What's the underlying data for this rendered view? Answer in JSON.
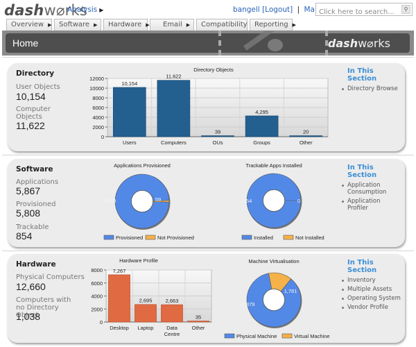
{
  "header": {
    "logo_bold": "dash",
    "logo_rest": "w⌀rks",
    "breadcrumb": "Analysis",
    "user": "bangell",
    "logout": "[Logout]",
    "separator": "|",
    "manage": "Manage",
    "search_placeholder": "Click here to search...",
    "search_icon": "search-icon"
  },
  "nav": {
    "tabs": [
      {
        "label": "Overview"
      },
      {
        "label": "Software"
      },
      {
        "label": "Hardware"
      },
      {
        "label": "Email"
      },
      {
        "label": "Compatibility"
      },
      {
        "label": "Reporting"
      }
    ]
  },
  "page": {
    "title": "Home",
    "brand_bold": "dash",
    "brand_rest": "w⌀rks"
  },
  "colors": {
    "bar_blue": "#235f8f",
    "bar_orange": "#e06a42",
    "donut_blue": "#5389e6",
    "donut_orange": "#f5b249",
    "link_blue": "#3b8ed6"
  },
  "directory": {
    "title": "Directory",
    "stats": [
      {
        "label": "User Objects",
        "value": "10,154"
      },
      {
        "label": "Computer Objects",
        "value": "11,622"
      }
    ],
    "section_heading": "In This Section",
    "links": [
      "Directory Browse"
    ]
  },
  "software": {
    "title": "Software",
    "stats": [
      {
        "label": "Applications",
        "value": "5,867"
      },
      {
        "label": "Provisioned",
        "value": "5,808"
      },
      {
        "label": "Trackable",
        "value": "854"
      }
    ],
    "section_heading": "In This Section",
    "links": [
      "Application Consumption",
      "Application Profiler"
    ]
  },
  "hardware": {
    "title": "Hardware",
    "stats": [
      {
        "label": "Physical Computers",
        "value": "12,660"
      },
      {
        "label": "Computers with no Directory Object",
        "value": "1,038"
      }
    ],
    "section_heading": "In This Section",
    "links": [
      "Inventory",
      "Multiple Assets",
      "Operating System",
      "Vendor Profile"
    ]
  },
  "chart_data": [
    {
      "id": "directory-objects",
      "type": "bar",
      "title": "Directory Objects",
      "categories": [
        "Users",
        "Computers",
        "OUs",
        "Groups",
        "Other"
      ],
      "values": [
        10154,
        11622,
        39,
        4295,
        20
      ],
      "labels": [
        "10,154",
        "11,622",
        "39",
        "4,295",
        "20"
      ],
      "yticks": [
        0,
        2000,
        4000,
        6000,
        8000,
        10000,
        12000
      ],
      "ylim": [
        0,
        12000
      ],
      "grid": true,
      "xlabel": "",
      "ylabel": ""
    },
    {
      "id": "applications-provisioned",
      "type": "pie",
      "donut": true,
      "title": "Applications Provisioned",
      "categories": [
        "Provisioned",
        "Not Provisioned"
      ],
      "values": [
        5808,
        59
      ],
      "labels": [
        "5,808",
        "59"
      ],
      "legend": "bottom"
    },
    {
      "id": "trackable-apps-installed",
      "type": "pie",
      "donut": true,
      "title": "Trackable Apps Installed",
      "categories": [
        "Installed",
        "Not Installed"
      ],
      "values": [
        854,
        0
      ],
      "labels": [
        "854",
        "0"
      ],
      "legend": "bottom"
    },
    {
      "id": "hardware-profile",
      "type": "bar",
      "title": "Hardware Profile",
      "categories": [
        "Desktop",
        "Laptop",
        "Data Centre",
        "Other"
      ],
      "values": [
        7267,
        2695,
        2663,
        35
      ],
      "labels": [
        "7,267",
        "2,695",
        "2,663",
        "35"
      ],
      "yticks": [
        0,
        2000,
        4000,
        6000,
        8000
      ],
      "ylim": [
        0,
        8000
      ],
      "grid": true,
      "xlabel": "",
      "ylabel": ""
    },
    {
      "id": "machine-virtualisation",
      "type": "pie",
      "donut": true,
      "title": "Machine Virtualisation",
      "categories": [
        "Physical Machine",
        "Virtual Machine"
      ],
      "values": [
        10879,
        1781
      ],
      "labels": [
        "10,879",
        "1,781"
      ],
      "legend": "bottom"
    }
  ]
}
